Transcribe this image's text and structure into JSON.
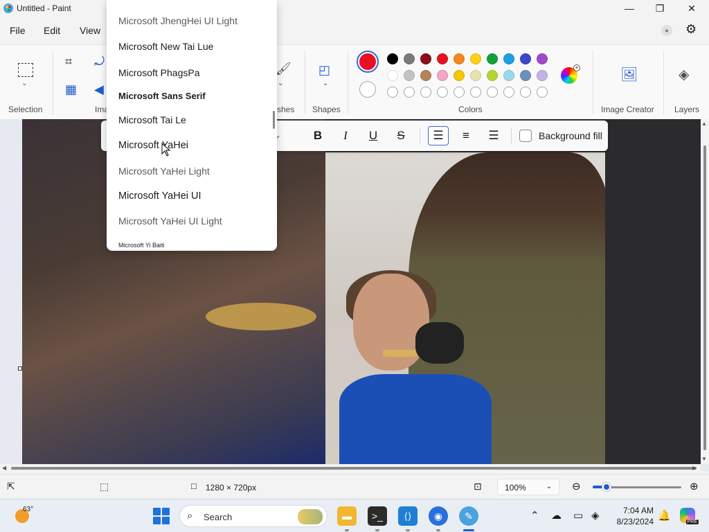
{
  "window": {
    "title": "Untitled - Paint"
  },
  "menu": {
    "file": "File",
    "edit": "Edit",
    "view": "View"
  },
  "ribbon": {
    "selection_label": "Selection",
    "image_label": "Ima",
    "brushes_label": "shes",
    "shapes_label": "Shapes",
    "colors_label": "Colors",
    "image_creator_label": "Image Creator",
    "layers_label": "Layers"
  },
  "colors": {
    "primary": "#e81123",
    "secondary": "#ffffff",
    "palette_row1": [
      "#000000",
      "#7a7a7a",
      "#8b0e1a",
      "#e81123",
      "#f7861e",
      "#fcd116",
      "#10a33a",
      "#1ca0e3",
      "#3a48c9",
      "#a14ac7"
    ],
    "palette_row2": [
      "#ffffff",
      "#c3c3c3",
      "#b5835a",
      "#f5a3c7",
      "#f7c600",
      "#e8e3b0",
      "#b5d631",
      "#99d9ea",
      "#6f8fbf",
      "#c4b4e4"
    ]
  },
  "text_toolbar": {
    "bold": "B",
    "italic": "I",
    "underline": "U",
    "strikethrough": "S",
    "background_fill_label": "Background fill",
    "background_fill_checked": false,
    "alignment_selected": "left"
  },
  "font_list": {
    "items": [
      "Microsoft JhengHei UI Light",
      "Microsoft New Tai Lue",
      "Microsoft PhagsPa",
      "Microsoft Sans Serif",
      "Microsoft Tai Le",
      "Microsoft YaHei",
      "Microsoft YaHei Light",
      "Microsoft YaHei UI",
      "Microsoft YaHei UI Light",
      "Microsoft Yi Baiti"
    ],
    "hovered": "Microsoft YaHei"
  },
  "status": {
    "canvas_size": "1280 × 720px",
    "zoom": "100%"
  },
  "taskbar": {
    "temperature": "63°",
    "search_label": "Search",
    "time": "7:04 AM",
    "date": "8/23/2024",
    "copilot_badge": "PRE"
  }
}
